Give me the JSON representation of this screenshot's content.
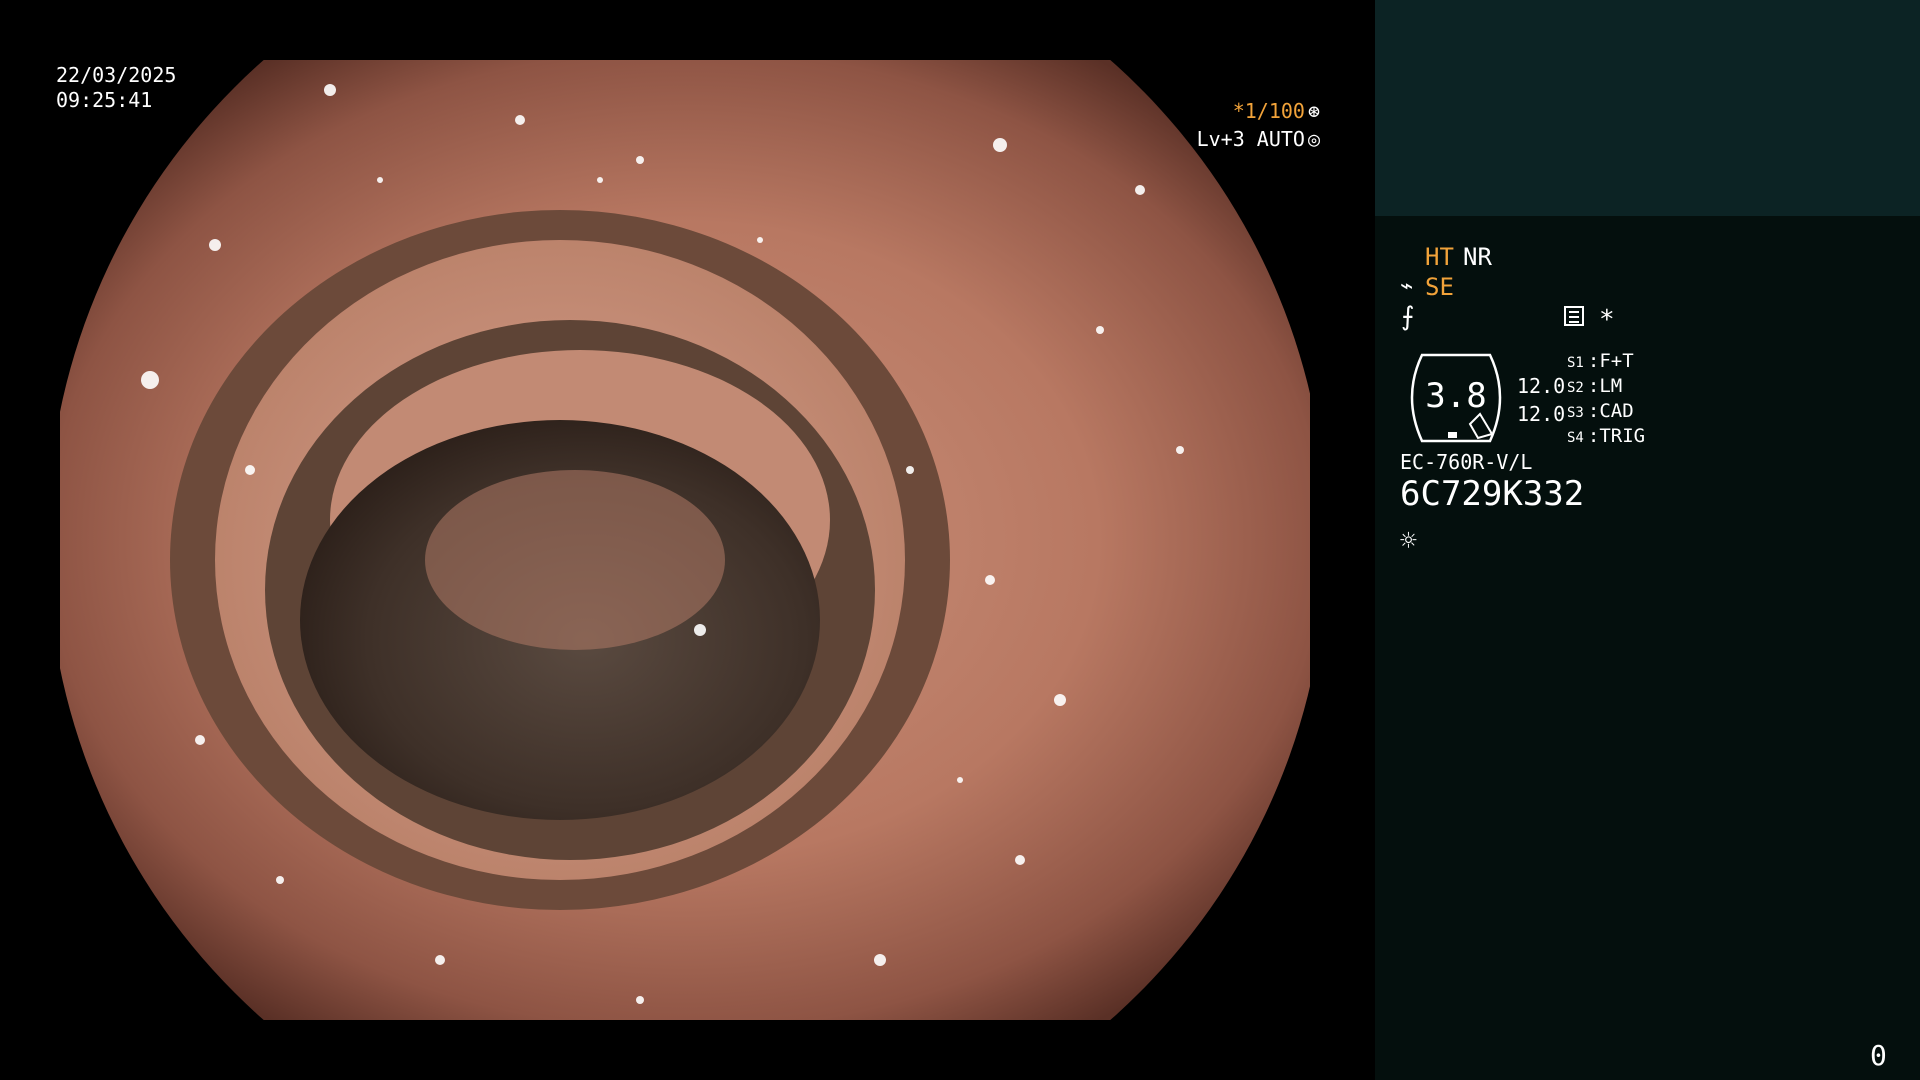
{
  "overlay": {
    "date": "22/03/2025",
    "time": "09:25:41",
    "shutter": "*1/100",
    "shutter_icon": "aperture-icon",
    "level": "Lv+3 AUTO",
    "level_icon": "auto-iris-icon"
  },
  "panel": {
    "ht": "HT",
    "nr": "NR",
    "se": "SE",
    "se_icon": "scope-tip-icon",
    "freeze_icon": "freeze-icon",
    "memo_icon": "memo-icon",
    "star": "*",
    "gauge_value": "3.8",
    "value_a": "12.0",
    "value_b": "12.0",
    "switches": [
      {
        "key": "S1",
        "value": "F+T"
      },
      {
        "key": "S2",
        "value": "LM"
      },
      {
        "key": "S3",
        "value": "CAD"
      },
      {
        "key": "S4",
        "value": "TRIG"
      }
    ],
    "model": "EC-760R-V/L",
    "serial": "6C729K332",
    "light_icon": "light-source-icon"
  },
  "counter": "0",
  "colors": {
    "accent": "#f2a33a",
    "panel_top": "#0c2324",
    "panel": "#040f0d",
    "tissue": "#b07560",
    "lumen": "#4a3a30"
  }
}
